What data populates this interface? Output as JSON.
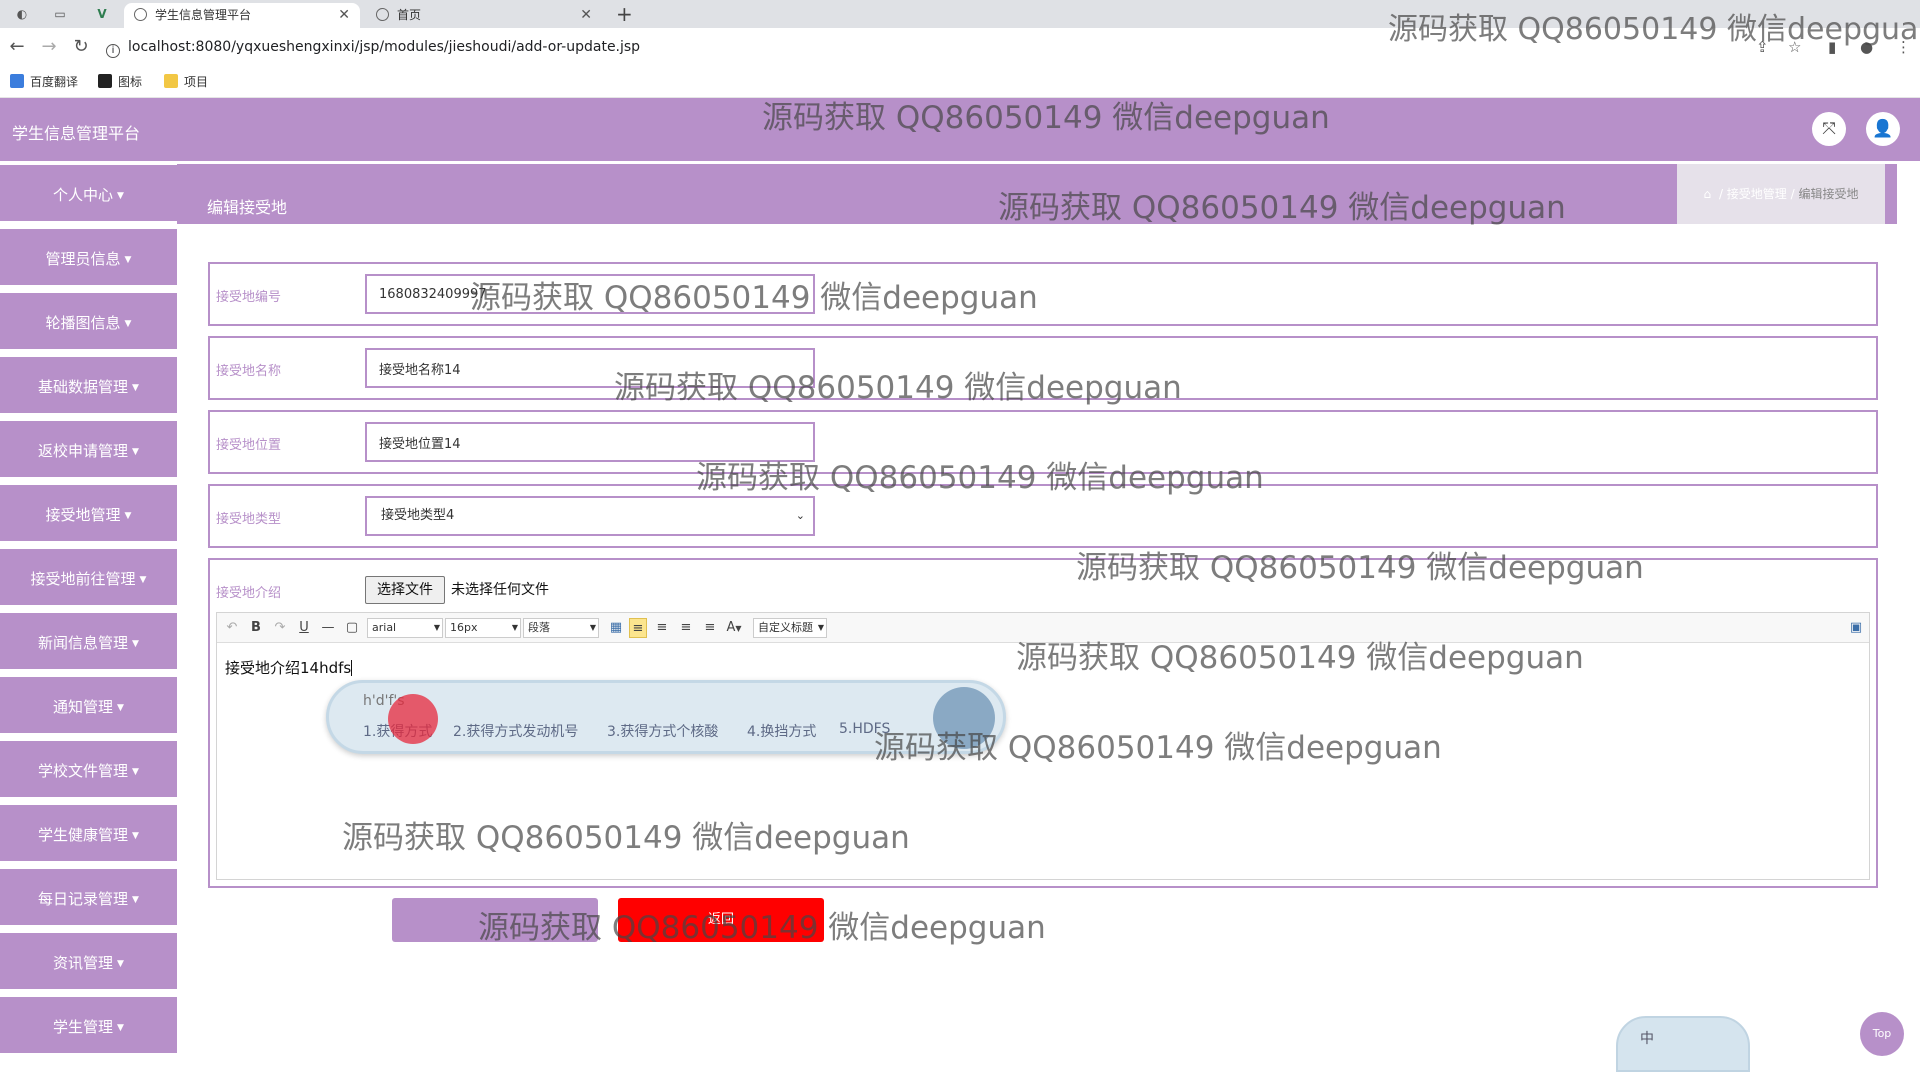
{
  "browser": {
    "tabs": [
      {
        "title": "学生信息管理平台",
        "active": true
      },
      {
        "title": "首页",
        "active": false
      }
    ],
    "url": "localhost:8080/yqxueshengxinxi/jsp/modules/jieshoudi/add-or-update.jsp",
    "bookmarks": [
      "百度翻译",
      "图标",
      "项目"
    ]
  },
  "header": {
    "app_title": "学生信息管理平台"
  },
  "sidebar": {
    "items": [
      "个人中心",
      "管理员信息",
      "轮播图信息",
      "基础数据管理",
      "返校申请管理",
      "接受地管理",
      "接受地前往管理",
      "新闻信息管理",
      "通知管理",
      "学校文件管理",
      "学生健康管理",
      "每日记录管理",
      "资讯管理",
      "学生管理"
    ]
  },
  "page": {
    "title": "编辑接受地",
    "breadcrumb": [
      "接受地管理",
      "编辑接受地"
    ]
  },
  "form": {
    "code_label": "接受地编号",
    "code_value": "1680832409997",
    "name_label": "接受地名称",
    "name_value": "接受地名称14",
    "location_label": "接受地位置",
    "location_value": "接受地位置14",
    "type_label": "接受地类型",
    "type_value": "接受地类型4",
    "intro_label": "接受地介绍",
    "file_button": "选择文件",
    "file_status": "未选择任何文件",
    "editor_text": "接受地介绍14hdfs"
  },
  "editor_toolbar": {
    "font_family": "arial",
    "font_size": "16px",
    "paragraph": "段落",
    "custom_title": "自定义标题",
    "bold": "B",
    "underline": "U",
    "font_color": "A"
  },
  "ime": {
    "input": "h'd'f's",
    "candidates": [
      "1.获得方式",
      "2.获得方式发动机号",
      "3.获得方式个核酸",
      "4.换挡方式",
      "5.HDFS"
    ],
    "status": "中"
  },
  "buttons": {
    "back": "返回",
    "top": "Top"
  },
  "watermark": "源码获取 QQ86050149 微信deepguan",
  "colors": {
    "accent": "#b790c9",
    "back_button": "#ff0000"
  }
}
